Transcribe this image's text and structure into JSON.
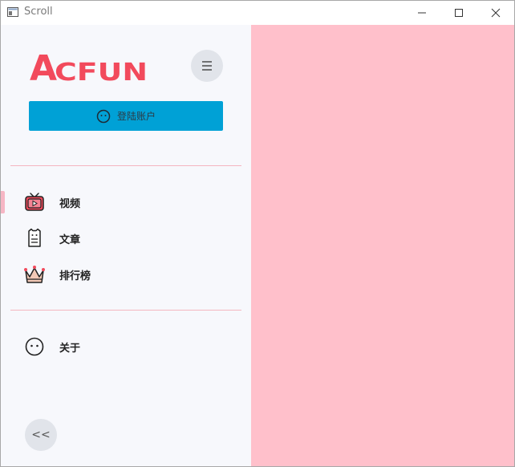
{
  "window": {
    "title": "Scroll"
  },
  "sidebar": {
    "logo_text": "ACFUN",
    "login_label": "登陆账户",
    "nav_items": [
      {
        "label": "视频",
        "icon": "tv-icon",
        "active": true
      },
      {
        "label": "文章",
        "icon": "article-icon",
        "active": false
      },
      {
        "label": "排行榜",
        "icon": "crown-icon",
        "active": false
      }
    ],
    "about_label": "关于",
    "collapse_symbol": "<<"
  },
  "colors": {
    "brand_red": "#f24a5c",
    "login_blue": "#00a1d6",
    "content_bg": "#ffc0cb",
    "divider": "#f4b6c0"
  }
}
